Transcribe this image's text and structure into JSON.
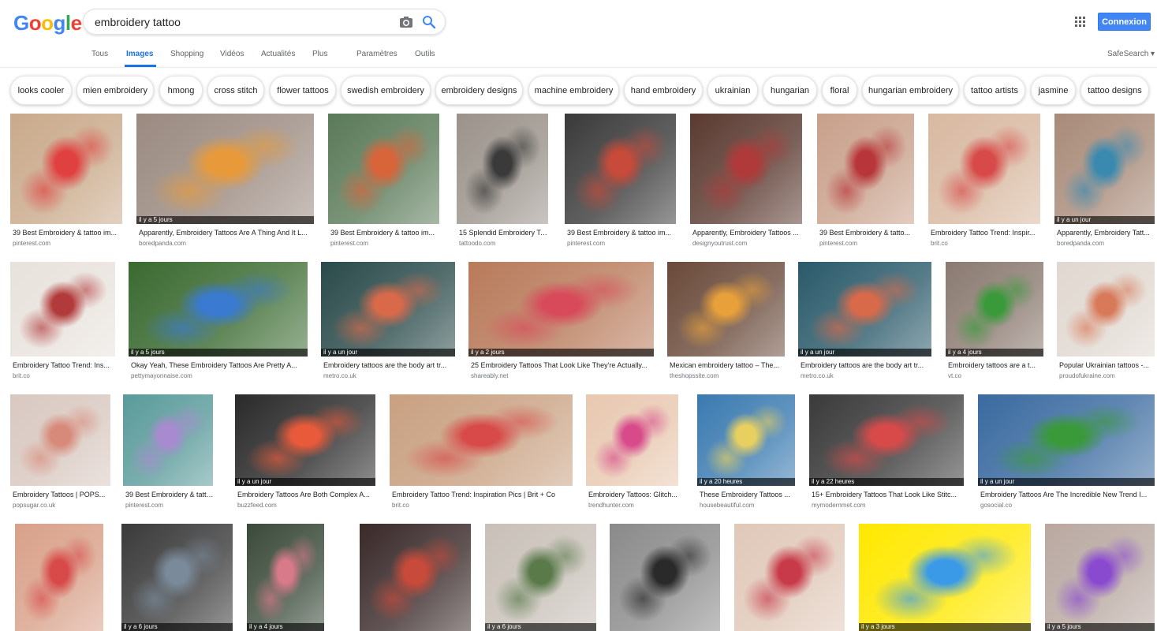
{
  "logo": [
    "G",
    "o",
    "o",
    "g",
    "l",
    "e"
  ],
  "search": {
    "value": "embroidery tattoo"
  },
  "header": {
    "signin_label": "Connexion"
  },
  "tabs": [
    "Tous",
    "Images",
    "Shopping",
    "Vidéos",
    "Actualités",
    "Plus",
    "Paramètres",
    "Outils"
  ],
  "safesearch": "SafeSearch ▾",
  "chips": [
    "looks cooler",
    "mien embroidery",
    "hmong",
    "cross stitch",
    "flower tattoos",
    "swedish embroidery",
    "embroidery designs",
    "machine embroidery",
    "hand embroidery",
    "ukrainian",
    "hungarian",
    "floral",
    "hungarian embroidery",
    "tattoo artists",
    "jasmine",
    "tattoo designs"
  ],
  "colors": {
    "accent": "#1a73e8",
    "signin": "#4285f4",
    "logo_blue": "#4285f4",
    "logo_red": "#ea4335",
    "logo_yellow": "#fbbc05",
    "logo_green": "#34a853"
  },
  "results": [
    {
      "title": "39 Best Embroidery & tattoo im...",
      "source": "pinterest.com",
      "age": "",
      "icon": "tattoo-photo"
    },
    {
      "title": "Apparently, Embroidery Tattoos Are A Thing And It L...",
      "source": "boredpanda.com",
      "age": "il y a 5 jours",
      "icon": "tattoo-photo"
    },
    {
      "title": "39 Best Embroidery & tattoo im...",
      "source": "pinterest.com",
      "age": "",
      "icon": "tattoo-photo"
    },
    {
      "title": "15 Splendid Embroidery Ta...",
      "source": "tattoodo.com",
      "age": "",
      "icon": "tattoo-photo"
    },
    {
      "title": "39 Best Embroidery & tattoo im...",
      "source": "pinterest.com",
      "age": "",
      "icon": "tattoo-photo"
    },
    {
      "title": "Apparently, Embroidery Tattoos ...",
      "source": "designyoutrust.com",
      "age": "",
      "icon": "tattoo-photo"
    },
    {
      "title": "39 Best Embroidery & tatto...",
      "source": "pinterest.com",
      "age": "",
      "icon": "tattoo-photo"
    },
    {
      "title": "Embroidery Tattoo Trend: Inspir...",
      "source": "brit.co",
      "age": "",
      "icon": "tattoo-photo"
    },
    {
      "title": "Apparently, Embroidery Tatt...",
      "source": "boredpanda.com",
      "age": "il y a un jour",
      "icon": "tattoo-photo"
    },
    {
      "title": "Embroidery Tattoo Trend: Ins...",
      "source": "brit.co",
      "age": "",
      "icon": "tattoo-photo"
    },
    {
      "title": "Okay Yeah, These Embroidery Tattoos Are Pretty A...",
      "source": "pettymayonnaise.com",
      "age": "il y a 5 jours",
      "icon": "tattoo-photo"
    },
    {
      "title": "Embroidery tattoos are the body art tr...",
      "source": "metro.co.uk",
      "age": "il y a un jour",
      "icon": "tattoo-photo"
    },
    {
      "title": "25 Embroidery Tattoos That Look Like They're Actually...",
      "source": "shareably.net",
      "age": "il y a 2 jours",
      "icon": "tattoo-photo"
    },
    {
      "title": "Mexican embroidery tattoo – The...",
      "source": "theshopssite.com",
      "age": "",
      "icon": "tattoo-photo"
    },
    {
      "title": "Embroidery tattoos are the body art tr...",
      "source": "metro.co.uk",
      "age": "il y a un jour",
      "icon": "tattoo-photo"
    },
    {
      "title": "Embroidery tattoos are a t...",
      "source": "vt.co",
      "age": "il y a 4 jours",
      "icon": "tattoo-photo"
    },
    {
      "title": "Popular Ukrainian tattoos -...",
      "source": "proudofukraine.com",
      "age": "",
      "icon": "tattoo-photo"
    },
    {
      "title": "Embroidery Tattoos | POPS...",
      "source": "popsugar.co.uk",
      "age": "",
      "icon": "tattoo-photo"
    },
    {
      "title": "39 Best Embroidery & tatto...",
      "source": "pinterest.com",
      "age": "",
      "icon": "tattoo-photo"
    },
    {
      "title": "Embroidery Tattoos Are Both Complex A...",
      "source": "buzzfeed.com",
      "age": "il y a un jour",
      "icon": "tattoo-photo"
    },
    {
      "title": "Embroidery Tattoo Trend: Inspiration Pics | Brit + Co",
      "source": "brit.co",
      "age": "",
      "icon": "tattoo-photo"
    },
    {
      "title": "Embroidery Tattoos: Glitch...",
      "source": "trendhunter.com",
      "age": "",
      "icon": "tattoo-photo"
    },
    {
      "title": "These Embroidery Tattoos ...",
      "source": "housebeautiful.com",
      "age": "il y a 20 heures",
      "icon": "tattoo-photo"
    },
    {
      "title": "15+ Embroidery Tattoos That Look Like Stitc...",
      "source": "mymodernmet.com",
      "age": "il y a 22 heures",
      "icon": "tattoo-photo"
    },
    {
      "title": "Embroidery Tattoos Are The Incredible New Trend I...",
      "source": "gosocial.co",
      "age": "il y a un jour",
      "icon": "tattoo-photo"
    },
    {
      "title": "",
      "source": "",
      "age": "",
      "icon": "tattoo-photo"
    },
    {
      "title": "",
      "source": "",
      "age": "il y a 6 jours",
      "icon": "tattoo-photo"
    },
    {
      "title": "",
      "source": "",
      "age": "il y a 4 jours",
      "icon": "tattoo-photo"
    },
    {
      "title": "",
      "source": "",
      "age": "",
      "icon": "tattoo-photo"
    },
    {
      "title": "",
      "source": "",
      "age": "il y a 6 jours",
      "icon": "tattoo-photo"
    },
    {
      "title": "",
      "source": "",
      "age": "",
      "icon": "tattoo-photo"
    },
    {
      "title": "",
      "source": "",
      "age": "",
      "icon": "tattoo-photo"
    },
    {
      "title": "",
      "source": "",
      "age": "il y a 3 jours",
      "icon": "tattoo-photo"
    },
    {
      "title": "",
      "source": "",
      "age": "il y a 5 jours",
      "icon": "tattoo-photo"
    }
  ]
}
